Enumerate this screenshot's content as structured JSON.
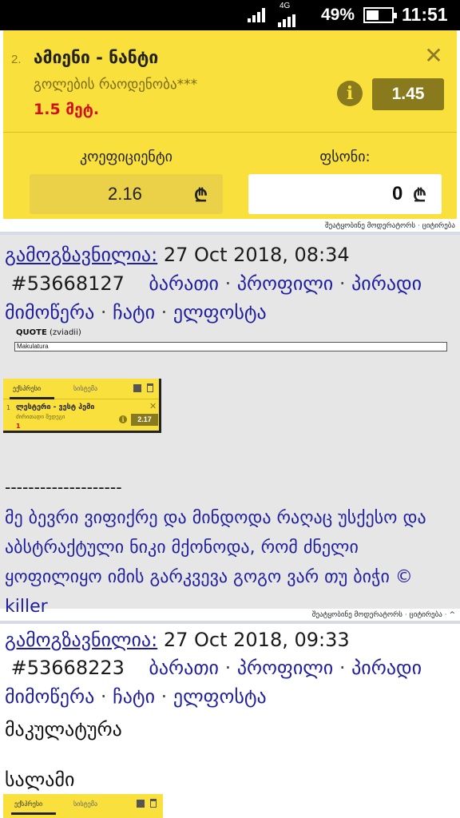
{
  "status_bar": {
    "network": "4G",
    "battery_percent": "49%",
    "battery_level": 0.49,
    "time": "11:51"
  },
  "bet_slip": {
    "number": "2.",
    "match": "ამიენი - ნანტი",
    "market": "გოლების რაოდენობა***",
    "pick": "1.5 მეტ.",
    "odds": "1.45",
    "coefficient_label": "კოეფიციენტი",
    "bet_label": "ფსონი:",
    "coefficient_value": "2.16",
    "bet_value": "0",
    "currency_symbol": "₾"
  },
  "post_actions": {
    "report": "შეატყობინე მოდერატორს",
    "separator": " · ",
    "quote": "ციტირება",
    "up": "^"
  },
  "posts": [
    {
      "sent_label": "გამოგზავნილია:",
      "datetime": "27 Oct 2018, 08:34",
      "post_id": "#53668127",
      "links": [
        "ბარათი",
        "პროფილი",
        "პირადი მიმოწერა",
        "ჩატი",
        "ელფოსტა"
      ],
      "quote_label": "QUOTE",
      "quote_author": "(zviadii)",
      "quote_text": "Makulatura",
      "mini_slip": {
        "tab1": "ექსპრესი",
        "tab2": "სისტემა",
        "number": "1",
        "match": "ლესტერი - ვესტ ჰემი",
        "market": "ძირითადი შედეგი",
        "pick": "1",
        "odds": "2.17"
      },
      "signature_line": "--------------------",
      "signature": "მე ბევრი ვიფიქრე და მინდოდა რაღაც უსქესო და აბსტრაქტული ნიკი მქონოდა, რომ ძნელი ყოფილიყო იმის გარკვევა გოგო ვარ თუ ბიჭი © killer"
    },
    {
      "sent_label": "გამოგზავნილია:",
      "datetime": "27 Oct 2018, 09:33",
      "post_id": "#53668223",
      "links": [
        "ბარათი",
        "პროფილი",
        "პირადი მიმოწერა",
        "ჩატი",
        "ელფოსტა"
      ],
      "body_lines": [
        "მაკულატურა",
        "",
        "სალამი"
      ],
      "mini_slip": {
        "tab1": "ექსპრესი",
        "tab2": "სისტემა"
      }
    }
  ],
  "colors": {
    "slip_yellow": "#f9e03c",
    "odds_bg": "#8a7a1e",
    "link_blue": "#1f1f9e",
    "pick_red": "#d1101c",
    "post_bg": "#e6e6e6"
  }
}
